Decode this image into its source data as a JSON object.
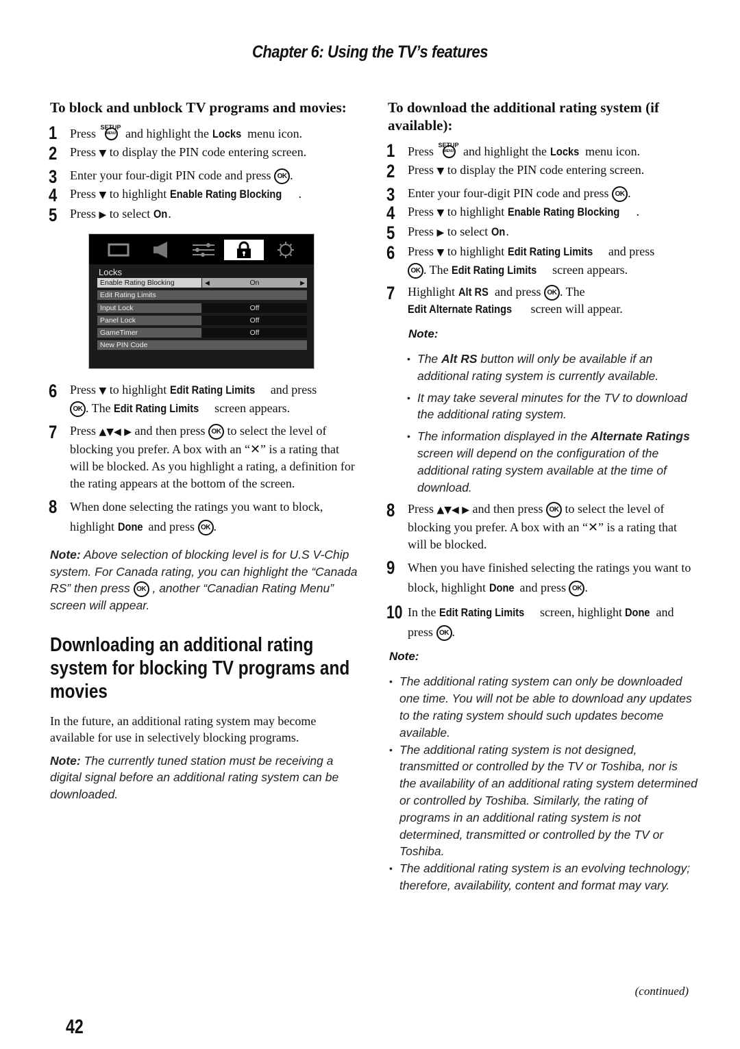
{
  "header": {
    "chapter_title": "Chapter 6: Using the TV’s features"
  },
  "left": {
    "heading": "To block and unblock TV programs and movies:",
    "steps": [
      {
        "n": "1",
        "pre": "Press",
        "icon": "setup-menu-button",
        "post": "and highlight the",
        "kw": "Locks",
        "end": "menu icon."
      },
      {
        "n": "2",
        "pre": "Press",
        "arrow": "▼",
        "post": "to display the PIN code entering screen."
      },
      {
        "n": "3",
        "pre": "Enter your four-digit PIN code and press",
        "end": "."
      },
      {
        "n": "4",
        "pre": "Press",
        "arrow": "▼",
        "post": "to highlight",
        "kw": "Enable Rating Blocking",
        "end": "."
      },
      {
        "n": "5",
        "pre": "Press",
        "arrow": "▶",
        "post": "to select",
        "kw": "On",
        "end": "."
      },
      {
        "n": "6",
        "pre": "Press",
        "arrow": "▼",
        "post": "to highlight",
        "kw": "Edit Rating Limits",
        "mid": "and press",
        "mid2": ". The",
        "kw2": "Edit Rating Limits",
        "end": "screen appears."
      },
      {
        "n": "7",
        "pre": "Press",
        "arrows": "▲▼◀ ▶",
        "mid": "and then press",
        "post": "to select the level of blocking you prefer. A box with an “✕” is a rating that will be blocked. As you highlight a rating, a definition for the rating appears at the bottom of the screen."
      },
      {
        "n": "8",
        "pre": "When done selecting the ratings you want to block, highlight",
        "kw": "Done",
        "post": "and press",
        "end": "."
      }
    ],
    "note": {
      "label": "Note:",
      "text1": "Above selection of blocking level is for U.S V-Chip system. For Canada rating, you can highlight the “Canada RS” then press",
      "text2": ", another “Canadian Rating Menu” screen will appear."
    },
    "section_heading": "Downloading an additional rating system for blocking TV programs and movies",
    "intro": "In the future, an additional rating system may become available for use in selectively blocking programs.",
    "note2": {
      "label": "Note:",
      "text": "The currently tuned station must be receiving a digital signal before an additional rating system can be downloaded."
    }
  },
  "tv_menu": {
    "icons": [
      "picture-icon",
      "audio-icon",
      "settings-sliders-icon",
      "lock-icon",
      "setup-gear-icon"
    ],
    "active_icon": "lock-icon",
    "title": "Locks",
    "rows": [
      {
        "label": "Enable Rating Blocking",
        "value": "On",
        "selected": true
      },
      {
        "label": "Edit Rating Limits",
        "value": ""
      },
      {
        "label": "Input Lock",
        "value": "Off"
      },
      {
        "label": "Panel Lock",
        "value": "Off"
      },
      {
        "label": "GameTimer",
        "value": "Off"
      },
      {
        "label": "New PIN Code",
        "value": ""
      }
    ]
  },
  "right": {
    "heading": "To download the additional rating system (if available):",
    "steps": [
      {
        "n": "1",
        "pre": "Press",
        "post": "and highlight the",
        "kw": "Locks",
        "end": "menu icon."
      },
      {
        "n": "2",
        "pre": "Press",
        "arrow": "▼",
        "post": "to display the PIN code entering screen."
      },
      {
        "n": "3",
        "pre": "Enter your four-digit PIN code and press",
        "end": "."
      },
      {
        "n": "4",
        "pre": "Press",
        "arrow": "▼",
        "post": "to highlight",
        "kw": "Enable Rating Blocking",
        "end": "."
      },
      {
        "n": "5",
        "pre": "Press",
        "arrow": "▶",
        "post": "to select",
        "kw": "On",
        "end": "."
      },
      {
        "n": "6",
        "pre": "Press",
        "arrow": "▼",
        "post": "to highlight",
        "kw": "Edit Rating Limits",
        "mid": "and press",
        "mid2": ". The",
        "kw2": "Edit Rating Limits",
        "end": "screen appears."
      },
      {
        "n": "7",
        "pre": "Highlight",
        "kw": "Alt RS",
        "mid": "and press",
        "mid2": ". The",
        "kw2": "Edit Alternate Ratings",
        "end": "screen will appear."
      },
      {
        "n": "8",
        "pre": "Press",
        "arrows": "▲▼◀ ▶",
        "mid": "and then press",
        "post": "to select the level of blocking you prefer. A box with an “✕” is a rating that will be blocked."
      },
      {
        "n": "9",
        "pre": "When you have finished selecting the ratings you want to block, highlight",
        "kw": "Done",
        "post": "and press",
        "end": "."
      },
      {
        "n": "10",
        "pre": "In the",
        "kw": "Edit Rating Limits",
        "mid": "screen, highlight",
        "kw2": "Done",
        "post": "and press",
        "end": "."
      }
    ],
    "note1": {
      "label": "Note:",
      "bullets": [
        {
          "a": "The",
          "b": "Alt RS",
          "c": "button will only be available if an additional rating system is currently available."
        },
        {
          "a": "It may take several minutes for the TV to download the additional rating system."
        },
        {
          "a": "The information displayed in the",
          "b": "Alternate Ratings",
          "c": "screen will depend on the configuration of the additional rating system available at the time of download."
        }
      ]
    },
    "note2": {
      "label": "Note:",
      "bullets": [
        "The additional rating system can only be downloaded one time. You will not be able to download any updates to the rating system should such updates become available.",
        "The additional rating system is not designed, transmitted or controlled by the TV or Toshiba, nor is the availability of an additional rating system determined or controlled by Toshiba. Similarly, the rating of programs in an additional rating system is not determined, transmitted or controlled by the TV or Toshiba.",
        "The additional rating system is an evolving technology; therefore, availability, content and format may vary."
      ]
    }
  },
  "footer": {
    "continued": "(continued)",
    "page_number": "42"
  },
  "buttons": {
    "ok": "OK",
    "setup": "SETUP",
    "menu": "MENU"
  }
}
